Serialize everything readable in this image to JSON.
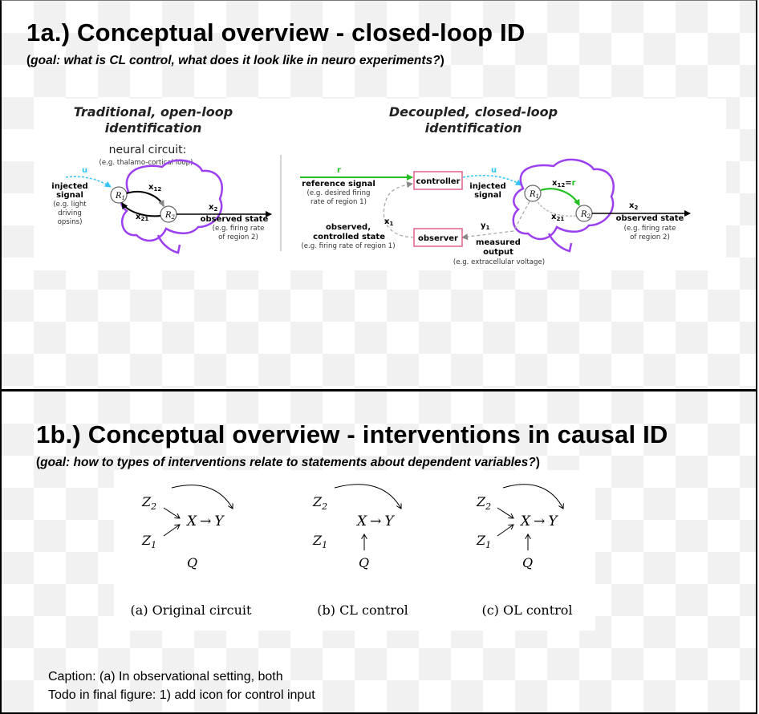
{
  "slide_a": {
    "title": "1a.) Conceptual overview - closed-loop ID",
    "subtitle_prefix": "(",
    "subtitle_text": "goal: what is CL control, what does it look like in neuro experiments?",
    "subtitle_suffix": ")",
    "open_loop": {
      "title_line1": "Traditional, open-loop",
      "title_line2": "identification",
      "circuit_label": "neural circuit:",
      "circuit_example": "(e.g. thalamo-cortical loop)",
      "u": "u",
      "injected_1": "injected",
      "injected_2": "signal",
      "injected_3": "(e.g. light",
      "injected_4": "driving",
      "injected_5": "opsins)",
      "r1": "R",
      "r1_sub": "1",
      "r2": "R",
      "r2_sub": "2",
      "x12": "x",
      "x12_sub": "12",
      "x21": "x",
      "x21_sub": "21",
      "x2": "x",
      "x2_sub": "2",
      "observed_state": "observed state",
      "obs_example_1": "(e.g. firing rate",
      "obs_example_2": "of region 2)"
    },
    "closed_loop": {
      "title_line1": "Decoupled, closed-loop",
      "title_line2": "identification",
      "r": "r",
      "reference_signal": "reference signal",
      "ref_example_1": "(e.g. desired firing",
      "ref_example_2": "rate of region 1)",
      "controller": "controller",
      "u": "u",
      "injected_1": "injected",
      "injected_2": "signal",
      "x12": "x",
      "x12_sub": "12",
      "x12_eq": "=",
      "x12_r": "r",
      "r1": "R",
      "r1_sub": "1",
      "r2": "R",
      "r2_sub": "2",
      "x21": "x",
      "x21_sub": "21",
      "x2": "x",
      "x2_sub": "2",
      "observed_state": "observed state",
      "obs_example_1": "(e.g. firing rate",
      "obs_example_2": "of region 2)",
      "x1": "x",
      "x1_sub": "1",
      "observed_ctrl_1": "observed,",
      "observed_ctrl_2": "controlled state",
      "observed_ctrl_3": "(e.g. firing rate of region 1)",
      "observer": "observer",
      "y1": "y",
      "y1_sub": "1",
      "measured_1": "measured",
      "measured_2": "output",
      "measured_3": "(e.g. extracellular voltage)"
    }
  },
  "slide_b": {
    "title": "1b.) Conceptual overview - interventions in causal ID",
    "subtitle_prefix": "(",
    "subtitle_text": "goal: how to types of interventions relate to statements about dependent variables?",
    "subtitle_suffix": ")",
    "graphs": [
      {
        "z2": "Z",
        "z2_sub": "2",
        "x": "X",
        "arrow": "→",
        "y": "Y",
        "z1": "Z",
        "z1_sub": "1",
        "q": "Q",
        "caption": "(a) Original circuit"
      },
      {
        "z2": "Z",
        "z2_sub": "2",
        "x": "X",
        "arrow": "→",
        "y": "Y",
        "z1": "Z",
        "z1_sub": "1",
        "q": "Q",
        "caption": "(b) CL control"
      },
      {
        "z2": "Z",
        "z2_sub": "2",
        "x": "X",
        "arrow": "→",
        "y": "Y",
        "z1": "Z",
        "z1_sub": "1",
        "q": "Q",
        "caption": "(c) OL control"
      }
    ],
    "caption_line1": "Caption: (a) In observational setting, both",
    "caption_line2": "Todo in final figure: 1) add icon for control input"
  },
  "colors": {
    "brain_outline": "#9b3ff0",
    "reference_green": "#22c022",
    "controller_pink": "#e0608a",
    "u_cyan": "#34c3f3"
  }
}
